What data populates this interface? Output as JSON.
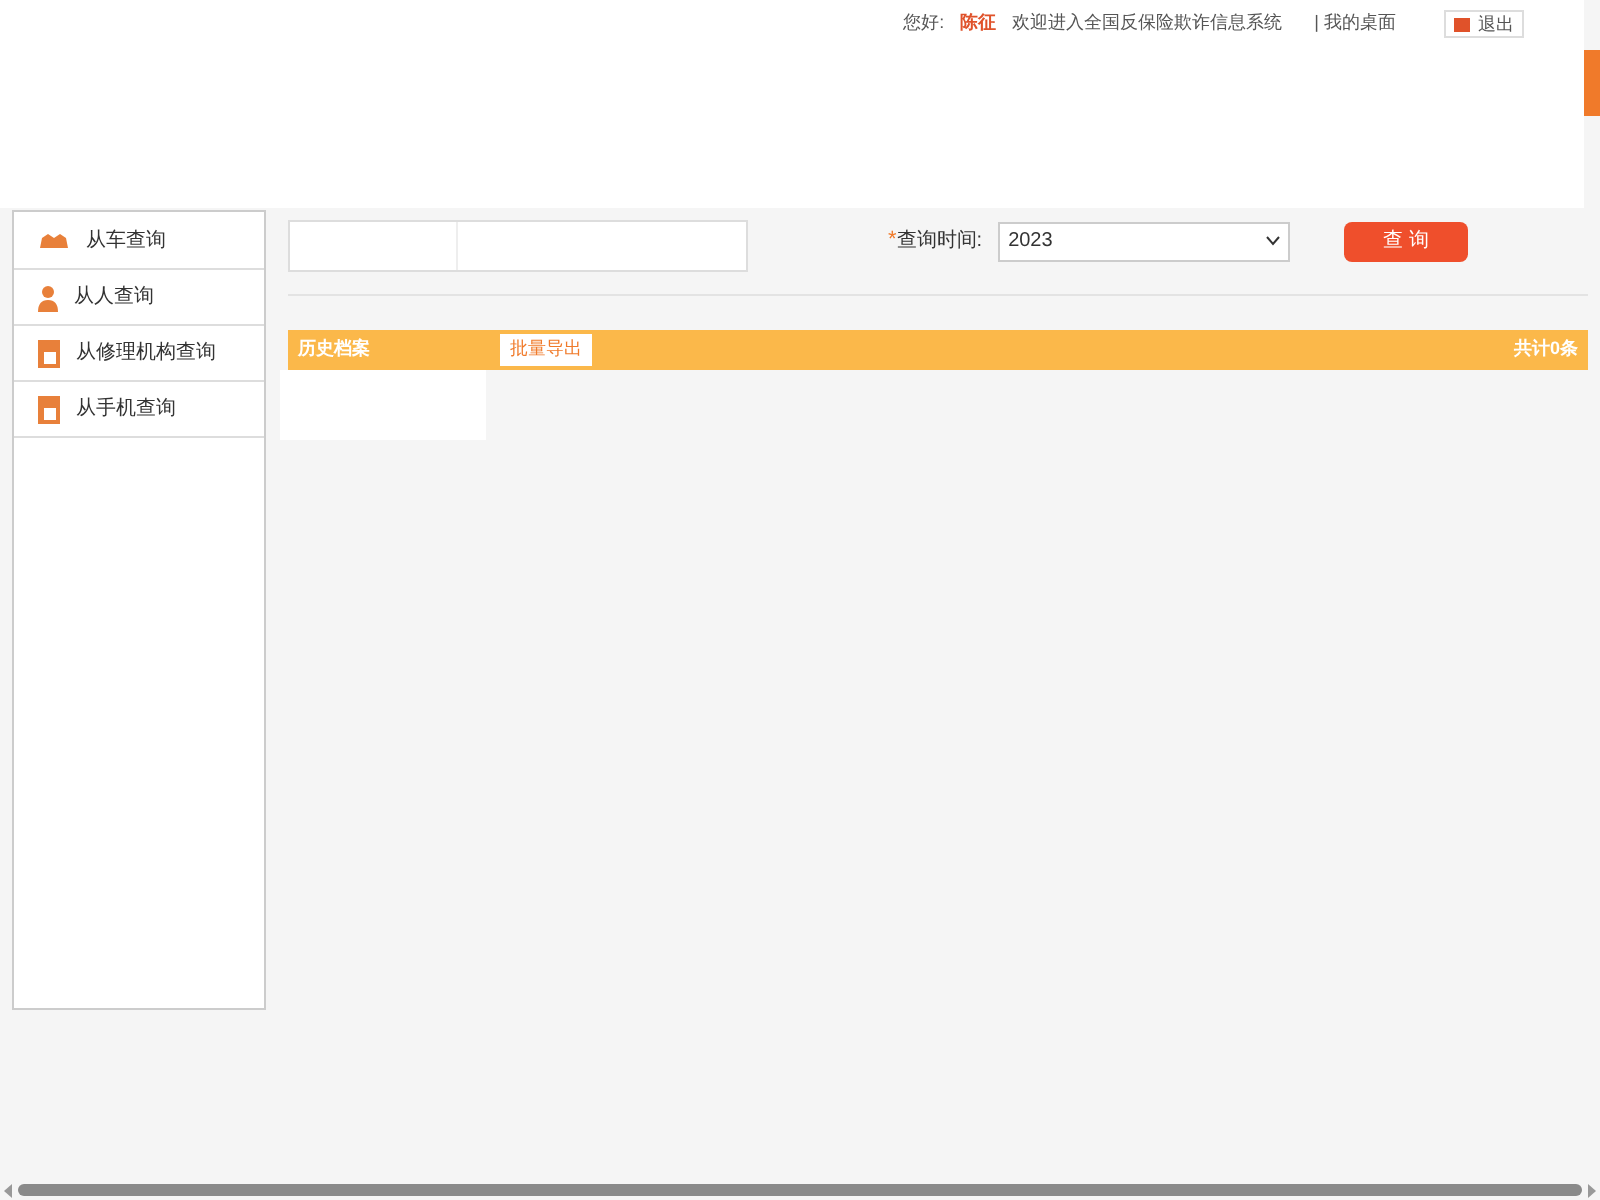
{
  "header": {
    "greeting": "您好:",
    "user": "陈征",
    "welcome": "欢迎进入全国反保险欺诈信息系统",
    "home_link": "| 我的桌面",
    "logout": "退出"
  },
  "sidebar": {
    "items": [
      {
        "label": "从车查询",
        "kind": "car"
      },
      {
        "label": "从人查询",
        "kind": "person"
      },
      {
        "label": "从修理机构查询",
        "kind": "doc"
      },
      {
        "label": "从手机查询",
        "kind": "doc"
      }
    ]
  },
  "query": {
    "time_label": "查询时间:",
    "required_mark": "*",
    "year": "2023",
    "button": "查 询"
  },
  "results": {
    "title": "历史档案",
    "export_button": "批量导出",
    "total": "共计0条"
  }
}
